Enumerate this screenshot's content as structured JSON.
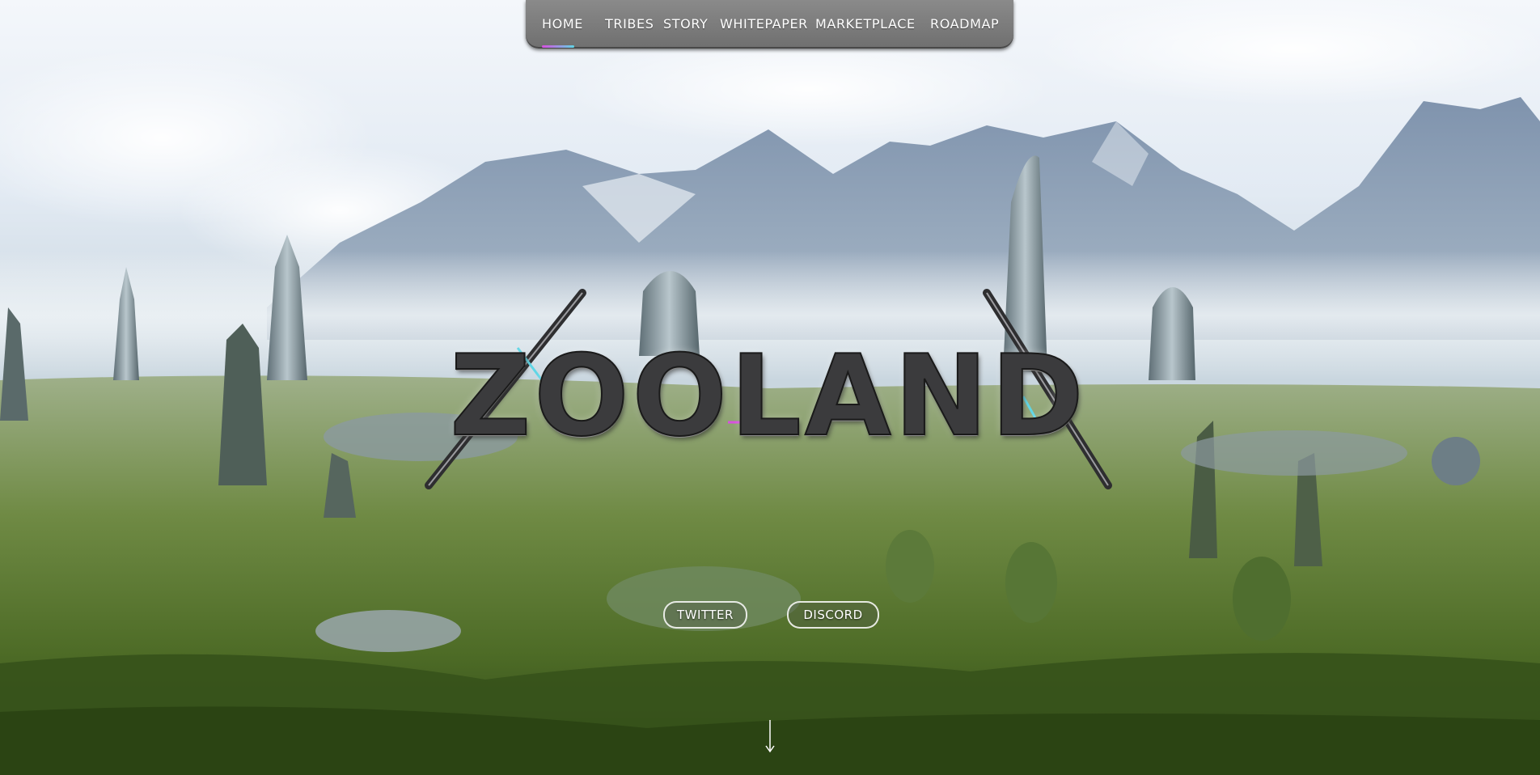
{
  "nav": {
    "items": [
      {
        "label": "HOME"
      },
      {
        "label": "TRIBES"
      },
      {
        "label": "STORY"
      },
      {
        "label": "WHITEPAPER"
      },
      {
        "label": "MARKETPLACE"
      },
      {
        "label": "ROADMAP"
      }
    ],
    "active": "HOME",
    "active_accent_colors": [
      "#d84fe0",
      "#5fd6e6"
    ]
  },
  "hero": {
    "logo_text": "ZOOLAND",
    "background_scene": "futuristic-city-landscape",
    "scroll_icon": "arrow-down-icon"
  },
  "social": {
    "twitter_label": "TWITTER",
    "discord_label": "DISCORD"
  },
  "colors": {
    "nav_background": "#7c7c7c",
    "text": "#ffffff",
    "logo_metal": "#3b3b3d",
    "accent_magenta": "#d84fe0",
    "accent_cyan": "#5fd6e6"
  }
}
